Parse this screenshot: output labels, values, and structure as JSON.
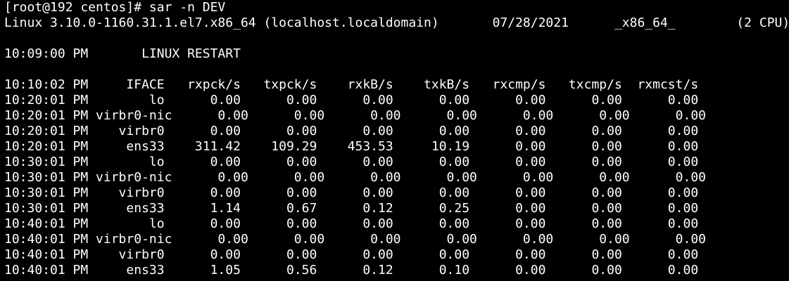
{
  "terminal": {
    "background": "#000000",
    "foreground": "#ffffff",
    "lines": [
      "[root@192 centos]# sar -n DEV",
      "Linux 3.10.0-1160.31.1.el7.x86_64 (localhost.localdomain)       07/28/2021      _x86_64_        (2 CPU)",
      "",
      "10:09:00 PM       LINUX RESTART",
      "",
      "10:10:02 PM     IFACE   rxpck/s   txpck/s    rxkB/s    txkB/s   rxcmp/s   txcmp/s  rxmcst/s",
      "10:20:01 PM        lo      0.00      0.00      0.00      0.00      0.00      0.00      0.00",
      "10:20:01 PM virbr0-nic      0.00      0.00      0.00      0.00      0.00      0.00      0.00",
      "10:20:01 PM    virbr0      0.00      0.00      0.00      0.00      0.00      0.00      0.00",
      "10:20:01 PM     ens33    311.42    109.29    453.53     10.19      0.00      0.00      0.00",
      "10:30:01 PM        lo      0.00      0.00      0.00      0.00      0.00      0.00      0.00",
      "10:30:01 PM virbr0-nic      0.00      0.00      0.00      0.00      0.00      0.00      0.00",
      "10:30:01 PM    virbr0      0.00      0.00      0.00      0.00      0.00      0.00      0.00",
      "10:30:01 PM     ens33      1.14      0.67      0.12      0.25      0.00      0.00      0.00",
      "10:40:01 PM        lo      0.00      0.00      0.00      0.00      0.00      0.00      0.00",
      "10:40:01 PM virbr0-nic      0.00      0.00      0.00      0.00      0.00      0.00      0.00",
      "10:40:01 PM    virbr0      0.00      0.00      0.00      0.00      0.00      0.00      0.00",
      "10:40:01 PM     ens33      1.05      0.56      0.12      0.10      0.00      0.00      0.00"
    ]
  }
}
